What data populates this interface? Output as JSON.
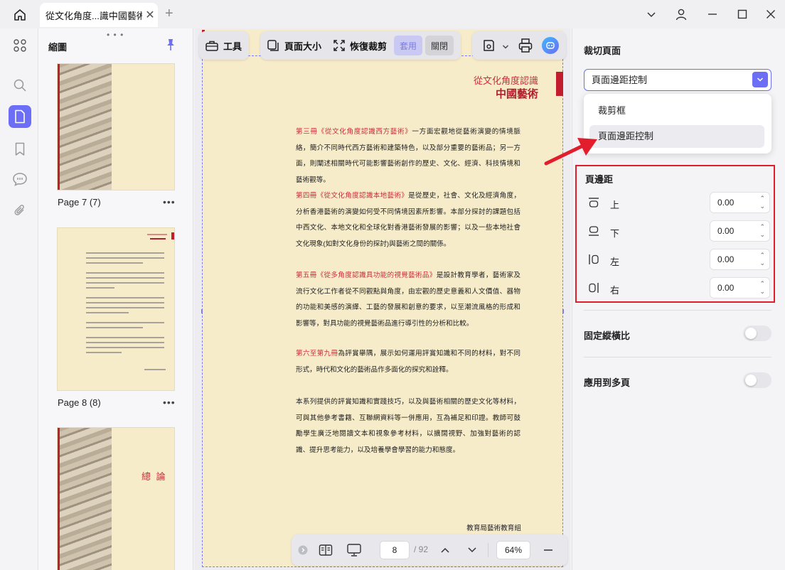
{
  "window": {
    "tab_title": "從文化角度...識中國藝術"
  },
  "thumbnails": {
    "title": "縮圖",
    "items": [
      {
        "label": "Page 7 (7)"
      },
      {
        "label": "Page 8 (8)"
      },
      {
        "label": "",
        "page_title": "總 論"
      }
    ]
  },
  "toolbar": {
    "tools_label": "工具",
    "page_size_label": "頁面大小",
    "restore_crop_label": "恢復裁剪",
    "apply_label": "套用",
    "close_label": "關閉"
  },
  "document": {
    "header_line1": "從文化角度認識",
    "header_line2": "中國藝術",
    "paragraphs": [
      {
        "highlight": "第三冊《從文化角度認識西方藝術》",
        "text": "一方面宏觀地從藝術演變的情境脈絡，簡介不同時代西方藝術和建築特色，以及部分重要的藝術品；另一方面，則闡述相關時代可能影響藝術創作的歷史、文化、經濟、科技情境和藝術觀等。"
      },
      {
        "highlight": "第四冊《從文化角度認識本地藝術》",
        "text": "是從歷史，社會、文化及經濟角度，分析香港藝術的演變如何受不同情境因素所影響。本部分探討的課題包括中西文化、本地文化和全球化對香港藝術發展的影響；以及一些本地社會文化現象(如對文化身份的探討)與藝術之間的關係。"
      },
      {
        "highlight": "第五冊《從多角度認識具功能的視覺藝術品》",
        "text": "是設計教育學者，藝術家及流行文化工作者從不同觀點與角度，由宏觀的歷史意義和人文價值、器物的功能和美感的演繹、工藝的發展和創意的要求，以至潮流風格的形成和影響等，對具功能的視覺藝術品進行導引性的分析和比較。"
      },
      {
        "highlight": "第六至第九冊",
        "text": "為評賞舉隅，展示如何運用評賞知識和不同的材料，對不同形式，時代和文化的藝術品作多面化的探究和詮釋。"
      },
      {
        "highlight": "",
        "text": "本系列提供的評賞知識和實踐技巧，以及與藝術相關的歷史文化等材料，可與其他參考書籍、互聯網資料等一併應用，互為補足和印證。教師可鼓勵學生廣泛地閱讀文本和視象參考材料，以擴闊視野、加強對藝術的認識、提升思考能力，以及培養學會學習的能力和態度。"
      }
    ],
    "signature": "教育局藝術教育組"
  },
  "bottom_bar": {
    "current_page": "8",
    "total_pages": "/ 92",
    "zoom": "64%"
  },
  "right_panel": {
    "title": "裁切頁面",
    "dropdown_value": "頁面邊距控制",
    "menu_items": [
      "裁剪框",
      "頁面邊距控制"
    ],
    "margins_title": "頁邊距",
    "margins": [
      {
        "label": "上",
        "value": "0.00",
        "icon": "margin-top-icon"
      },
      {
        "label": "下",
        "value": "0.00",
        "icon": "margin-bottom-icon"
      },
      {
        "label": "左",
        "value": "0.00",
        "icon": "margin-left-icon"
      },
      {
        "label": "右",
        "value": "0.00",
        "icon": "margin-right-icon"
      }
    ],
    "lock_ratio_label": "固定縱橫比",
    "apply_multiple_label": "應用到多頁",
    "lock_ratio_on": false,
    "apply_multiple_on": false
  },
  "colors": {
    "accent": "#6c6ef5",
    "highlight_red": "#e21d2c",
    "page_bg": "#f7ecca"
  }
}
